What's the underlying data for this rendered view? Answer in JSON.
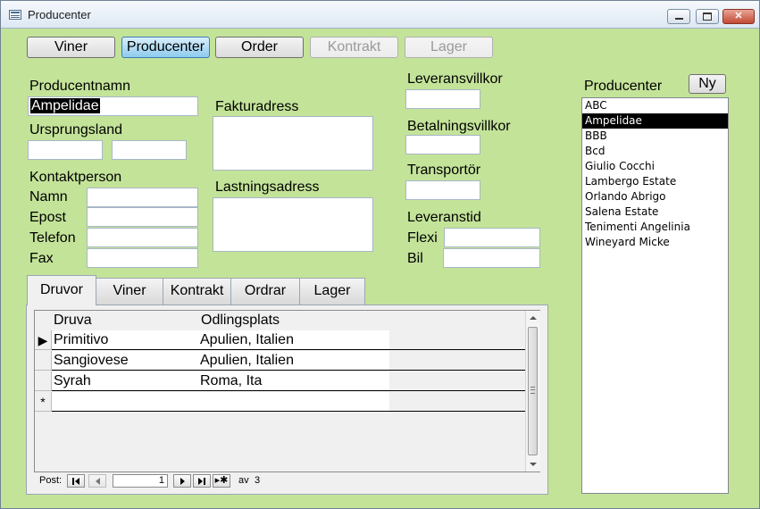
{
  "window": {
    "title": "Producenter"
  },
  "nav": {
    "buttons": [
      "Viner",
      "Producenter",
      "Order",
      "Kontrakt",
      "Lager"
    ]
  },
  "form": {
    "producentnamn_label": "Producentnamn",
    "producentnamn_value": "Ampelidae",
    "ursprungsland_label": "Ursprungsland",
    "kontaktperson_label": "Kontaktperson",
    "namn_label": "Namn",
    "epost_label": "Epost",
    "telefon_label": "Telefon",
    "fax_label": "Fax",
    "fakturadress_label": "Fakturadress",
    "lastningsadress_label": "Lastningsadress",
    "leveransvillkor_label": "Leveransvillkor",
    "betalningsvillkor_label": "Betalningsvillkor",
    "transportor_label": "Transportör",
    "leveranstid_label": "Leveranstid",
    "flexi_label": "Flexi",
    "bil_label": "Bil"
  },
  "producer_list": {
    "label": "Producenter",
    "new_button": "Ny",
    "items": [
      "ABC",
      "Ampelidae",
      "BBB",
      "Bcd",
      "Giulio Cocchi",
      "Lambergo Estate",
      "Orlando Abrigo",
      "Salena Estate",
      "Tenimenti Angelinia",
      "Wineyard Micke"
    ],
    "selected_index": 1
  },
  "tabs": [
    "Druvor",
    "Viner",
    "Kontrakt",
    "Ordrar",
    "Lager"
  ],
  "grid": {
    "headers": [
      "Druva",
      "Odlingsplats"
    ],
    "rows": [
      {
        "druva": "Primitivo",
        "odlingsplats": "Apulien, Italien"
      },
      {
        "druva": "Sangiovese",
        "odlingsplats": "Apulien, Italien"
      },
      {
        "druva": "Syrah",
        "odlingsplats": "Roma, Ita"
      }
    ],
    "current_marker": "▶",
    "new_marker": "*"
  },
  "record_nav": {
    "label": "Post:",
    "current": "1",
    "of_label": "av",
    "total": "3"
  }
}
